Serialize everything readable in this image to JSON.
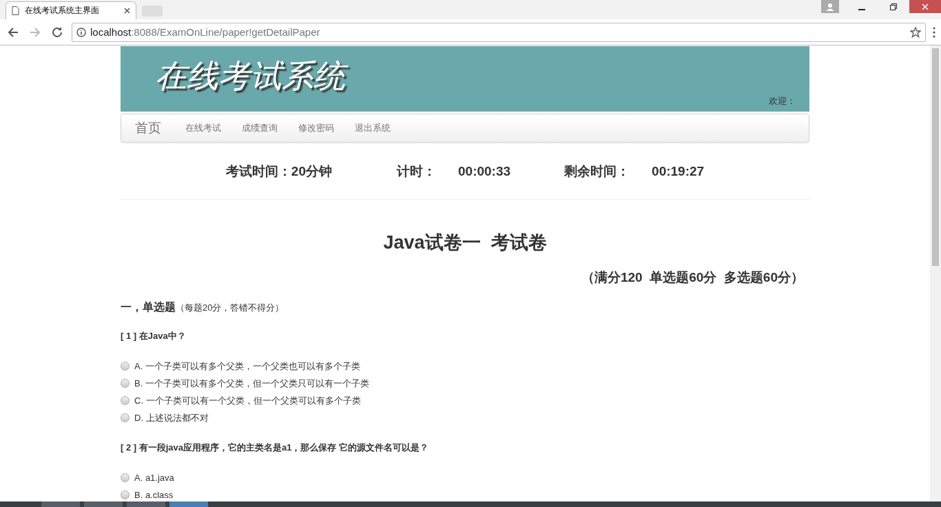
{
  "browser": {
    "tab_title": "在线考试系统主界面",
    "url_host": "localhost",
    "url_path": ":8088/ExamOnLine/paper!getDetailPaper"
  },
  "header": {
    "title": "在线考试系统",
    "welcome": "欢迎："
  },
  "nav": [
    {
      "label": "首页",
      "kind": "brand"
    },
    {
      "label": "在线考试",
      "kind": "link"
    },
    {
      "label": "成绩查询",
      "kind": "link"
    },
    {
      "label": "修改密码",
      "kind": "link"
    },
    {
      "label": "退出系统",
      "kind": "link"
    }
  ],
  "timer": {
    "duration": "考试时间：20分钟",
    "elapsed_label": "计时：",
    "elapsed": "00:00:33",
    "remaining_label": "剩余时间：",
    "remaining": "00:19:27"
  },
  "paper": {
    "title": "Java试卷一  考试卷",
    "score": "（满分120  单选题60分  多选题60分）"
  },
  "section": {
    "heading": "一，单选题",
    "note": "（每题20分，答错不得分）"
  },
  "questions": [
    {
      "number": "[ 1 ]",
      "text": "在Java中？",
      "options": [
        {
          "label": "A. 一个子类可以有多个父类，一个父类也可以有多个子类",
          "selected": false
        },
        {
          "label": "B. 一个子类可以有多个父类，但一个父类只可以有一个子类",
          "selected": false
        },
        {
          "label": "C. 一个子类可以有一个父类，但一个父类可以有多个子类",
          "selected": false
        },
        {
          "label": "D. 上述说法都不对",
          "selected": false
        }
      ]
    },
    {
      "number": "[ 2 ]",
      "text": "有一段java应用程序，它的主类名是a1，那么保存 它的源文件名可以是？",
      "options": [
        {
          "label": "A. a1.java",
          "selected": false
        },
        {
          "label": "B. a.class",
          "selected": false
        }
      ]
    }
  ]
}
